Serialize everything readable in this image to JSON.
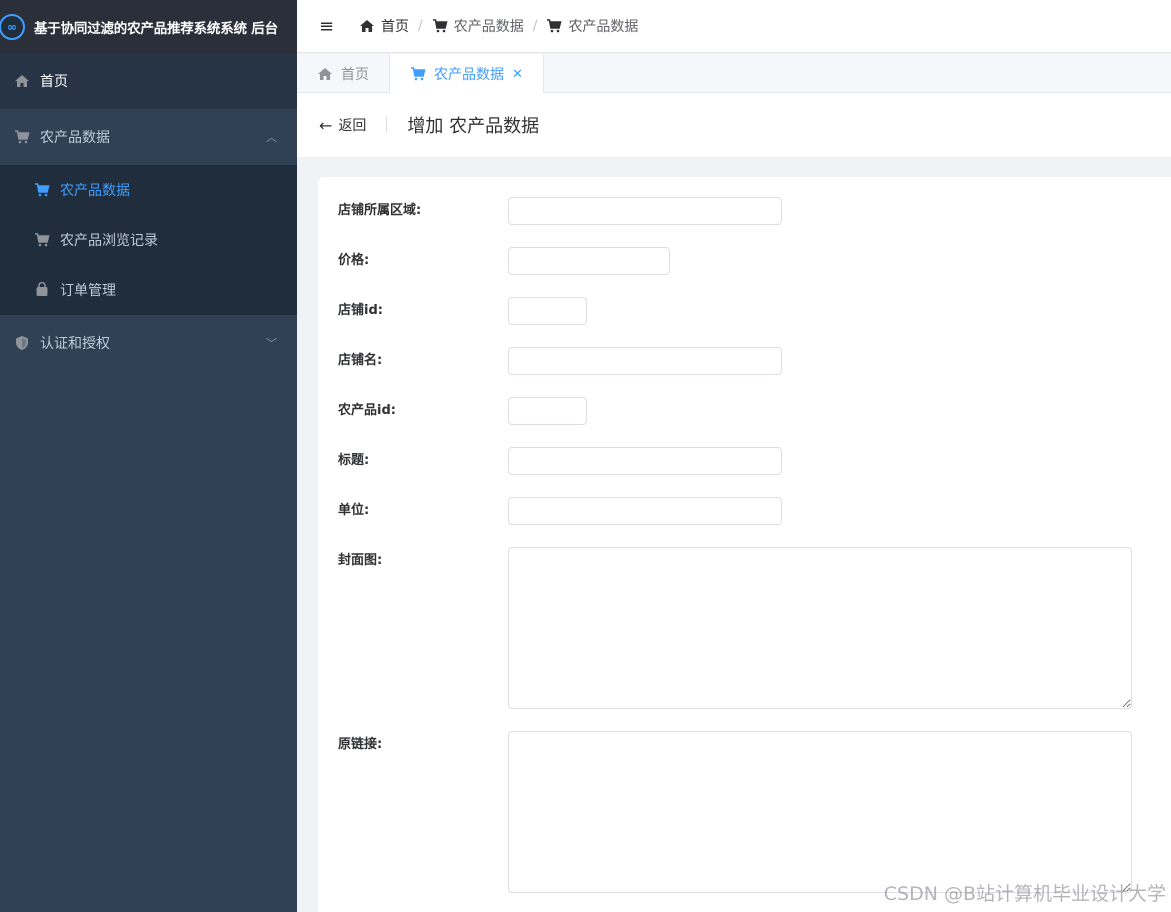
{
  "app": {
    "title": "基于协同过滤的农产品推荐系统系统 后台"
  },
  "sidebar": {
    "items": [
      {
        "label": "首页",
        "icon": "home-icon"
      },
      {
        "label": "农产品数据",
        "icon": "cart-icon",
        "expanded": true,
        "children": [
          {
            "label": "农产品数据",
            "icon": "cart-icon",
            "active": true
          },
          {
            "label": "农产品浏览记录",
            "icon": "cart-icon"
          },
          {
            "label": "订单管理",
            "icon": "bag-icon"
          }
        ]
      },
      {
        "label": "认证和授权",
        "icon": "shield-icon",
        "expanded": false
      }
    ]
  },
  "header": {
    "breadcrumb": [
      "首页",
      "农产品数据",
      "农产品数据"
    ]
  },
  "tabs": [
    {
      "label": "首页",
      "active": false
    },
    {
      "label": "农产品数据",
      "active": true
    }
  ],
  "page": {
    "back_label": "返回",
    "title": "增加 农产品数据"
  },
  "form": {
    "fields": [
      {
        "label": "店铺所属区域:",
        "value": ""
      },
      {
        "label": "价格:",
        "value": ""
      },
      {
        "label": "店铺id:",
        "value": ""
      },
      {
        "label": "店铺名:",
        "value": ""
      },
      {
        "label": "农产品id:",
        "value": ""
      },
      {
        "label": "标题:",
        "value": ""
      },
      {
        "label": "单位:",
        "value": ""
      },
      {
        "label": "封面图:",
        "value": ""
      },
      {
        "label": "原链接:",
        "value": ""
      }
    ]
  },
  "watermark": "CSDN @B站计算机毕业设计大学",
  "colors": {
    "accent": "#409eff",
    "sidebar_bg": "#304156",
    "logo_bg": "#2b2f3a"
  }
}
